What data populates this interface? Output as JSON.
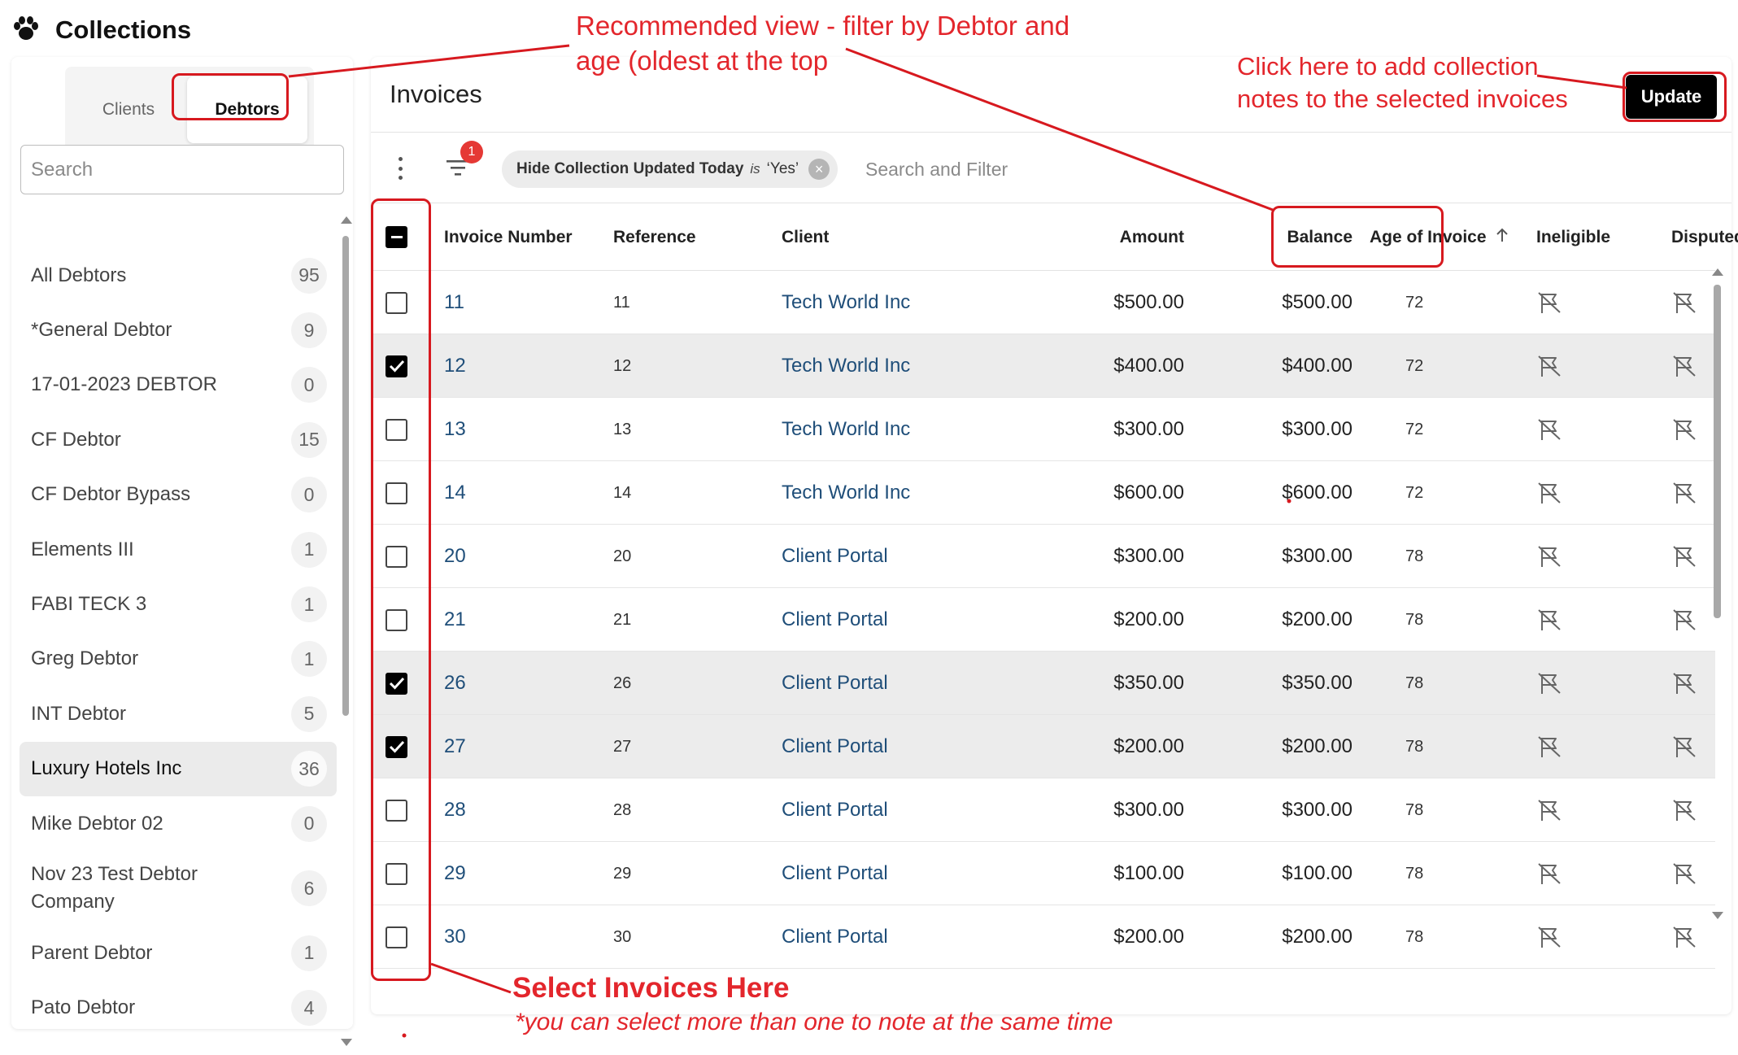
{
  "app": {
    "title": "Collections",
    "logo_icon": "paw-icon"
  },
  "sidebar": {
    "tabs": [
      {
        "label": "Clients",
        "active": false
      },
      {
        "label": "Debtors",
        "active": true
      }
    ],
    "search": {
      "placeholder": "Search",
      "value": ""
    },
    "debtors": [
      {
        "name": "All Debtors",
        "count": "95",
        "selected": false
      },
      {
        "name": "*General Debtor",
        "count": "9",
        "selected": false
      },
      {
        "name": "17-01-2023 DEBTOR",
        "count": "0",
        "selected": false
      },
      {
        "name": "CF Debtor",
        "count": "15",
        "selected": false
      },
      {
        "name": "CF Debtor Bypass",
        "count": "0",
        "selected": false
      },
      {
        "name": "Elements III",
        "count": "1",
        "selected": false
      },
      {
        "name": "FABI TECK 3",
        "count": "1",
        "selected": false
      },
      {
        "name": "Greg Debtor",
        "count": "1",
        "selected": false
      },
      {
        "name": "INT Debtor",
        "count": "5",
        "selected": false
      },
      {
        "name": "Luxury Hotels Inc",
        "count": "36",
        "selected": true
      },
      {
        "name": "Mike Debtor 02",
        "count": "0",
        "selected": false
      },
      {
        "name": "Nov 23 Test Debtor Company",
        "count": "6",
        "selected": false
      },
      {
        "name": "Parent Debtor",
        "count": "1",
        "selected": false
      },
      {
        "name": "Pato Debtor",
        "count": "4",
        "selected": false
      }
    ]
  },
  "main": {
    "title": "Invoices",
    "update_label": "Update",
    "toolbar": {
      "filter_badge": "1",
      "chip": {
        "field": "Hide Collection Updated Today",
        "op": "is",
        "value": "‘Yes’"
      },
      "search_placeholder": "Search and Filter"
    },
    "columns": {
      "invoice_number": "Invoice Number",
      "reference": "Reference",
      "client": "Client",
      "amount": "Amount",
      "balance": "Balance",
      "age": "Age of Invoice",
      "age_sort_icon": "arrow-up-icon",
      "ineligible": "Ineligible",
      "disputed": "Disputed"
    },
    "rows": [
      {
        "invoice": "11",
        "reference": "11",
        "client": "Tech World Inc",
        "amount": "$500.00",
        "balance": "$500.00",
        "age": "72",
        "checked": false
      },
      {
        "invoice": "12",
        "reference": "12",
        "client": "Tech World Inc",
        "amount": "$400.00",
        "balance": "$400.00",
        "age": "72",
        "checked": true
      },
      {
        "invoice": "13",
        "reference": "13",
        "client": "Tech World Inc",
        "amount": "$300.00",
        "balance": "$300.00",
        "age": "72",
        "checked": false
      },
      {
        "invoice": "14",
        "reference": "14",
        "client": "Tech World Inc",
        "amount": "$600.00",
        "balance": "$600.00",
        "age": "72",
        "checked": false
      },
      {
        "invoice": "20",
        "reference": "20",
        "client": "Client Portal",
        "amount": "$300.00",
        "balance": "$300.00",
        "age": "78",
        "checked": false
      },
      {
        "invoice": "21",
        "reference": "21",
        "client": "Client Portal",
        "amount": "$200.00",
        "balance": "$200.00",
        "age": "78",
        "checked": false
      },
      {
        "invoice": "26",
        "reference": "26",
        "client": "Client Portal",
        "amount": "$350.00",
        "balance": "$350.00",
        "age": "78",
        "checked": true
      },
      {
        "invoice": "27",
        "reference": "27",
        "client": "Client Portal",
        "amount": "$200.00",
        "balance": "$200.00",
        "age": "78",
        "checked": true
      },
      {
        "invoice": "28",
        "reference": "28",
        "client": "Client Portal",
        "amount": "$300.00",
        "balance": "$300.00",
        "age": "78",
        "checked": false
      },
      {
        "invoice": "29",
        "reference": "29",
        "client": "Client Portal",
        "amount": "$100.00",
        "balance": "$100.00",
        "age": "78",
        "checked": false
      },
      {
        "invoice": "30",
        "reference": "30",
        "client": "Client Portal",
        "amount": "$200.00",
        "balance": "$200.00",
        "age": "78",
        "checked": false
      }
    ]
  },
  "annotations": {
    "recommended_view": [
      "Recommended view - filter by Debtor and",
      "age (oldest at the top"
    ],
    "update_hint": [
      "Click here to add collection",
      "notes to the selected invoices"
    ],
    "select_title": "Select Invoices Here",
    "select_note": "*you can select more than one to note at the same time",
    "color": "#e3262c"
  },
  "colors": {
    "link": "#1f4e79",
    "primary_button": "#000000",
    "selected_row": "#ececec",
    "badge": "#e53935"
  }
}
